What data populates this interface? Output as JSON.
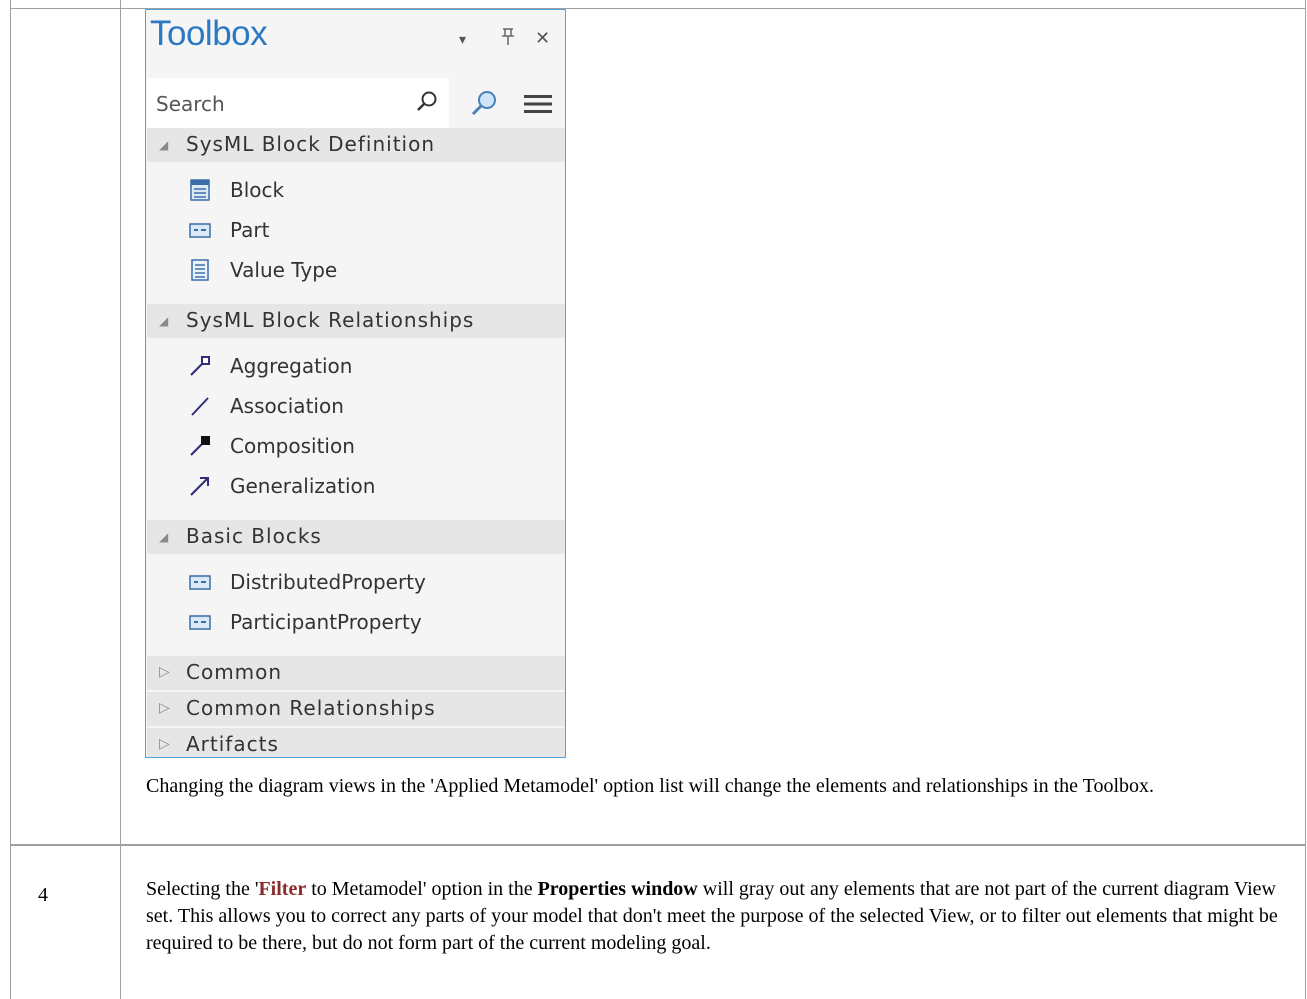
{
  "toolbox": {
    "title": "Toolbox",
    "controls": {
      "dropdown_glyph": "▾",
      "pin_glyph": "ᛘ",
      "close_glyph": "✕"
    },
    "search_placeholder": "Search",
    "accent_color": "#2b79c2",
    "sections": [
      {
        "label": "SysML Block Definition",
        "expanded": true,
        "items": [
          {
            "label": "Block",
            "icon": "block-icon"
          },
          {
            "label": "Part",
            "icon": "part-icon"
          },
          {
            "label": "Value Type",
            "icon": "value-type-icon"
          }
        ]
      },
      {
        "label": "SysML Block Relationships",
        "expanded": true,
        "items": [
          {
            "label": "Aggregation",
            "icon": "aggregation-icon"
          },
          {
            "label": "Association",
            "icon": "association-icon"
          },
          {
            "label": "Composition",
            "icon": "composition-icon"
          },
          {
            "label": "Generalization",
            "icon": "generalization-icon"
          }
        ]
      },
      {
        "label": "Basic Blocks",
        "expanded": true,
        "items": [
          {
            "label": "DistributedProperty",
            "icon": "property-icon"
          },
          {
            "label": "ParticipantProperty",
            "icon": "property-icon"
          }
        ]
      },
      {
        "label": "Common",
        "expanded": false,
        "items": []
      },
      {
        "label": "Common Relationships",
        "expanded": false,
        "items": []
      },
      {
        "label": "Artifacts",
        "expanded": false,
        "items": []
      }
    ]
  },
  "caption": "Changing the diagram views in the 'Applied Metamodel' option list will change the elements and relationships in the Toolbox.",
  "row4": {
    "number": "4",
    "text_before": "Selecting the '",
    "filter_word": "Filter",
    "text_mid": " to Metamodel' option in the ",
    "properties_window": "Properties window",
    "text_after": " will gray out any elements that are not part of the current diagram View set. This allows you to correct any parts of your model that don't meet the purpose of the selected View, or to filter out elements that might be required to be there, but do not form part of the current modeling goal."
  }
}
